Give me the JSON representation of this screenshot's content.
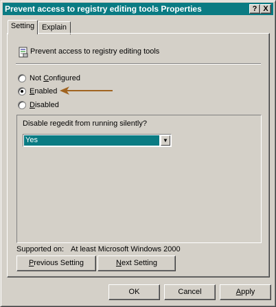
{
  "window": {
    "title": "Prevent access to registry editing tools Properties",
    "help_glyph": "?",
    "close_glyph": "X"
  },
  "tabs": [
    {
      "label": "Setting",
      "selected": true
    },
    {
      "label": "Explain",
      "selected": false
    }
  ],
  "policy": {
    "icon": "policy-setting-icon",
    "title": "Prevent access to registry editing tools"
  },
  "options": {
    "not_configured": {
      "mnemonic": "C",
      "pre": "Not ",
      "post": "onfigured",
      "checked": false
    },
    "enabled": {
      "mnemonic": "E",
      "pre": "",
      "post": "nabled",
      "checked": true
    },
    "disabled": {
      "mnemonic": "D",
      "pre": "",
      "post": "isabled",
      "checked": false
    }
  },
  "annotation": {
    "icon": "arrow-left-icon",
    "color": "#a0631f"
  },
  "settings_box": {
    "label": "Disable regedit from running silently?",
    "combo_value": "Yes",
    "combo_arrow": "▼"
  },
  "supported": {
    "label": "Supported on:",
    "value": "At least Microsoft Windows 2000"
  },
  "nav_buttons": {
    "previous": {
      "mnemonic": "P",
      "rest": "revious Setting"
    },
    "next": {
      "mnemonic": "N",
      "rest": "ext Setting"
    }
  },
  "dialog_buttons": {
    "ok": "OK",
    "cancel": "Cancel",
    "apply": {
      "mnemonic": "A",
      "rest": "pply"
    }
  },
  "colors": {
    "titlebar": "#0a7b83",
    "selection": "#0a7b83",
    "face": "#d4d0c8"
  }
}
